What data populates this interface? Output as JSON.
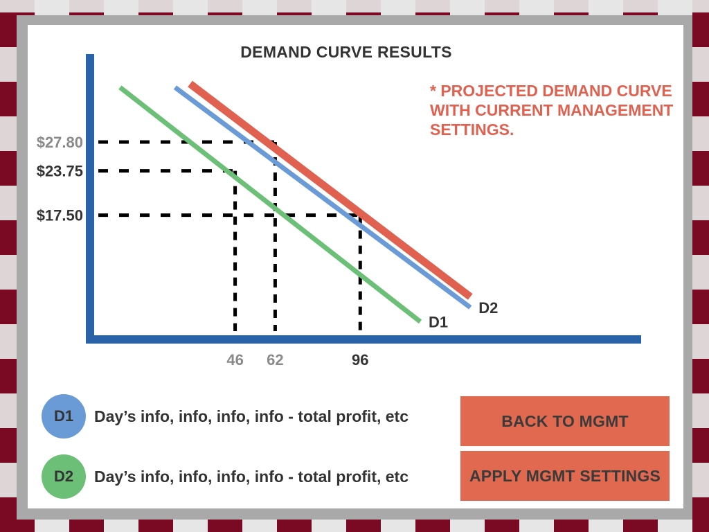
{
  "chart_data": {
    "type": "line",
    "title": "DEMAND CURVE RESULTS",
    "note": "* PROJECTED DEMAND CURVE WITH CURRENT MANAGEMENT SETTINGS.",
    "series": [
      {
        "name": "D1",
        "color": "#6cbf76",
        "x": [
          0,
          120
        ],
        "y": [
          35.5,
          2.5
        ]
      },
      {
        "name": "D2",
        "color": "#6b9bd6",
        "x": [
          22,
          140
        ],
        "y": [
          35.5,
          4.5
        ]
      },
      {
        "name": "",
        "color": "#e06150",
        "x": [
          28,
          140
        ],
        "y": [
          36,
          6
        ]
      }
    ],
    "x_ticks": [
      {
        "value": 46,
        "label": "46",
        "color": "#8a8a8a"
      },
      {
        "value": 62,
        "label": "62",
        "color": "#8a8a8a"
      },
      {
        "value": 96,
        "label": "96",
        "color": "#333333"
      }
    ],
    "y_ticks": [
      {
        "value": 27.8,
        "label": "$27.80",
        "color": "#8a8a8a"
      },
      {
        "value": 23.75,
        "label": "$23.75",
        "color": "#333333"
      },
      {
        "value": 17.5,
        "label": "$17.50",
        "color": "#333333"
      }
    ],
    "guides": [
      {
        "x": 46,
        "y": 23.75
      },
      {
        "x": 62,
        "y": 27.8
      },
      {
        "x": 96,
        "y": 17.5
      }
    ],
    "xlim": [
      -12,
      208
    ],
    "ylim": [
      0,
      40
    ],
    "axis_color": "#2a62a8",
    "grid": false
  },
  "legend": [
    {
      "badge": "D1",
      "text": "Day’s info, info, info, info - total profit, etc",
      "color": "#6b9bd6"
    },
    {
      "badge": "D2",
      "text": "Day’s info, info, info, info - total profit, etc",
      "color": "#6cbf76"
    }
  ],
  "buttons": {
    "back": "BACK TO MGMT",
    "apply": "APPLY MGMT SETTINGS"
  }
}
